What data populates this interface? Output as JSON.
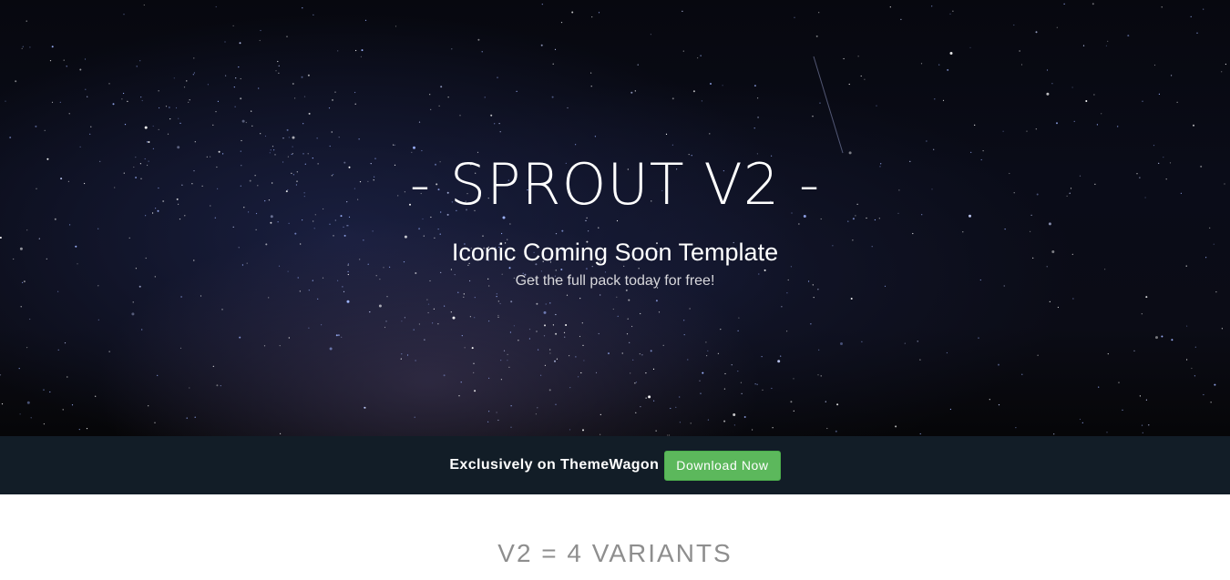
{
  "hero": {
    "title": "- SPROUT V2 -",
    "subtitle": "Iconic Coming Soon Template",
    "tagline": "Get the full pack today for free!",
    "background": "starry-night-sky"
  },
  "promo_bar": {
    "text": "Exclusively on ThemeWagon",
    "button_label": "Download Now",
    "background_color": "#121d27",
    "button_color": "#5cb85c"
  },
  "content": {
    "heading": "V2 = 4 VARIANTS"
  }
}
